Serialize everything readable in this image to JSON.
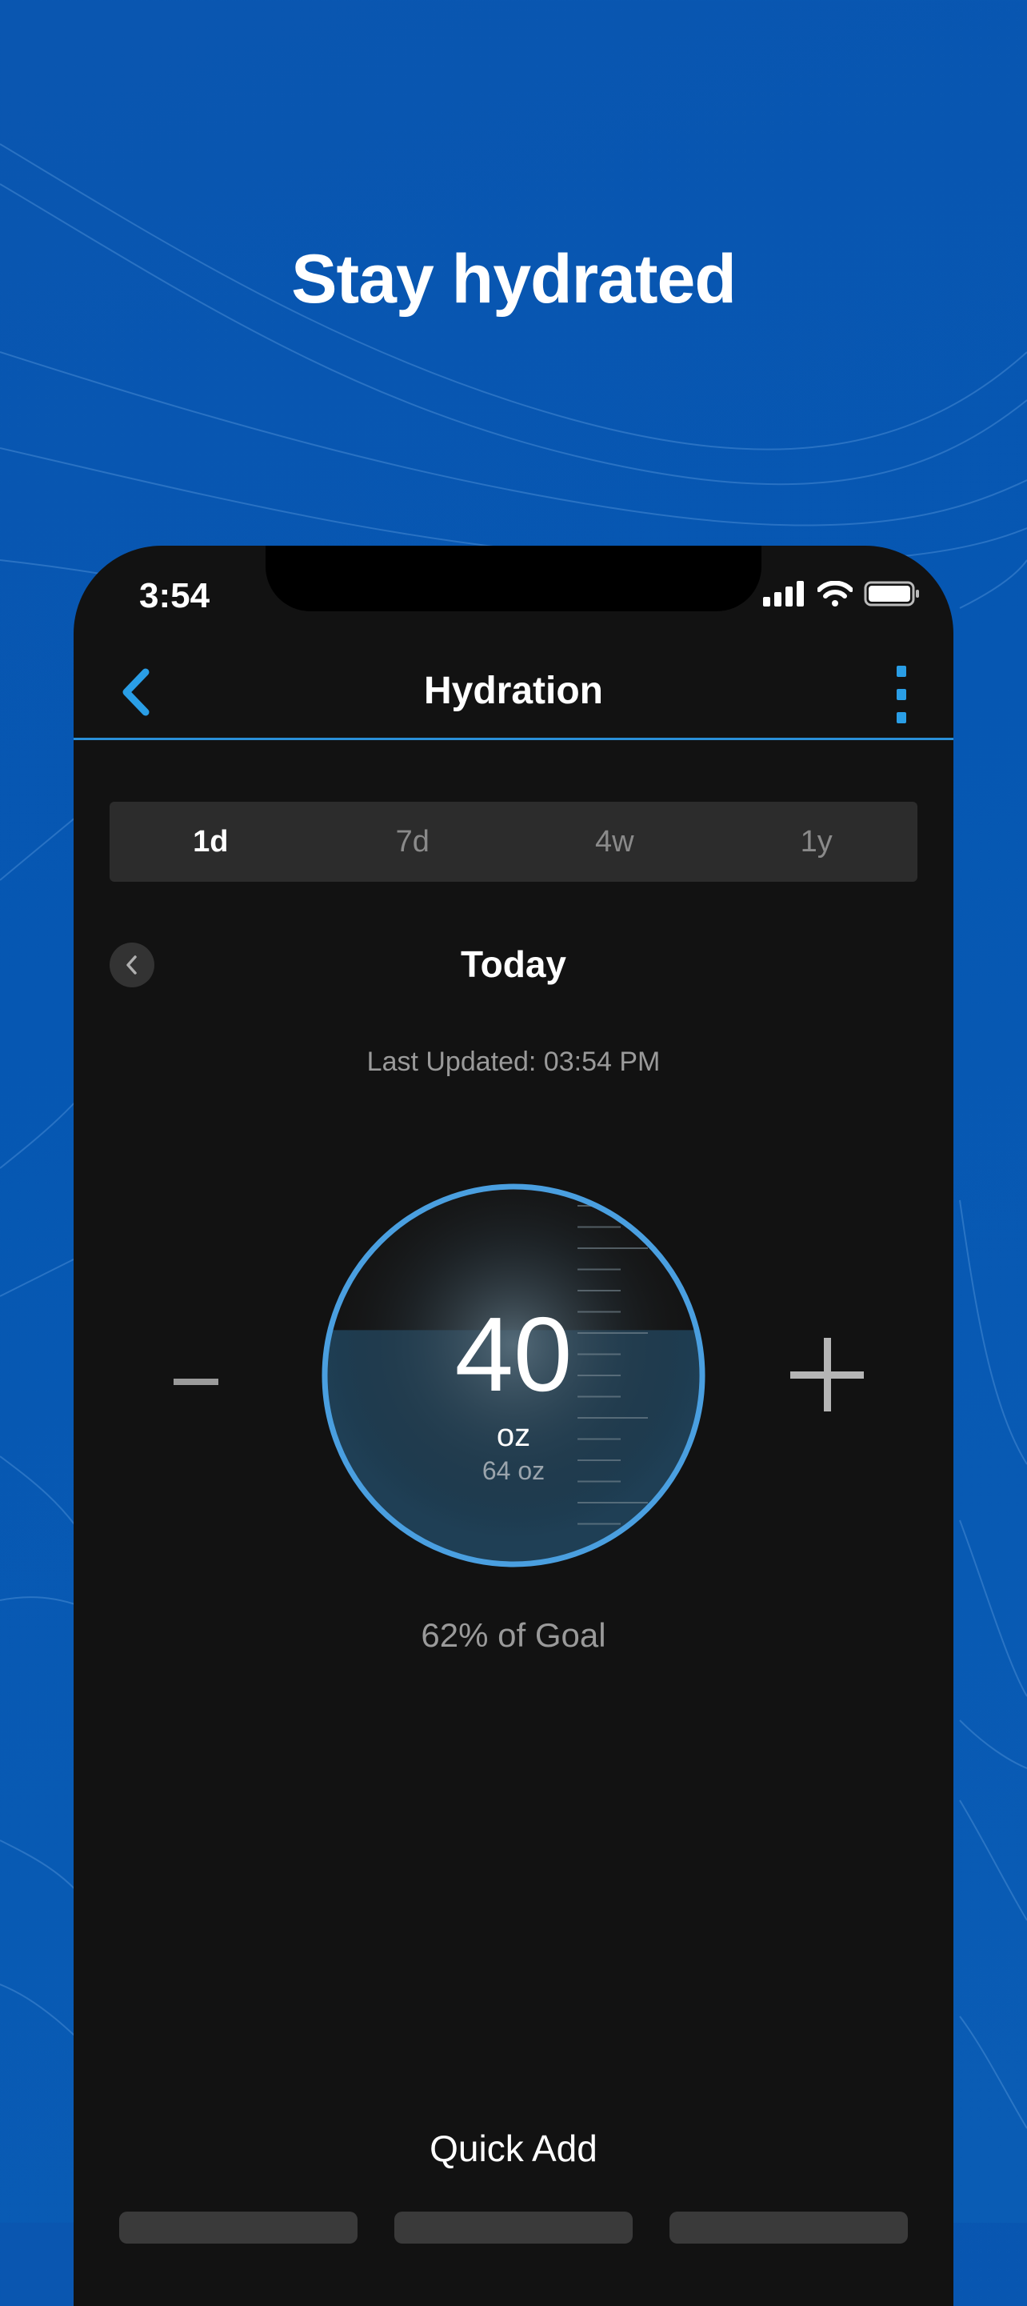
{
  "headline": "Stay hydrated",
  "status_bar": {
    "time": "3:54"
  },
  "nav": {
    "title": "Hydration",
    "back_icon": "chevron-left-icon",
    "more_icon": "vertical-ellipsis-icon"
  },
  "tabs": [
    {
      "label": "1d",
      "active": true
    },
    {
      "label": "7d",
      "active": false
    },
    {
      "label": "4w",
      "active": false
    },
    {
      "label": "1y",
      "active": false
    }
  ],
  "day": {
    "label": "Today",
    "last_updated": "Last Updated: 03:54 PM"
  },
  "gauge": {
    "value": "40",
    "unit": "oz",
    "goal": "64 oz",
    "fill_fraction": 0.62
  },
  "percent_of_goal": "62% of Goal",
  "quick_add": {
    "label": "Quick Add"
  },
  "colors": {
    "background": "#0657b2",
    "accent": "#2a9ee6",
    "ring": "#4a9fe0",
    "water": "#1f3f55",
    "screen": "#121212"
  }
}
